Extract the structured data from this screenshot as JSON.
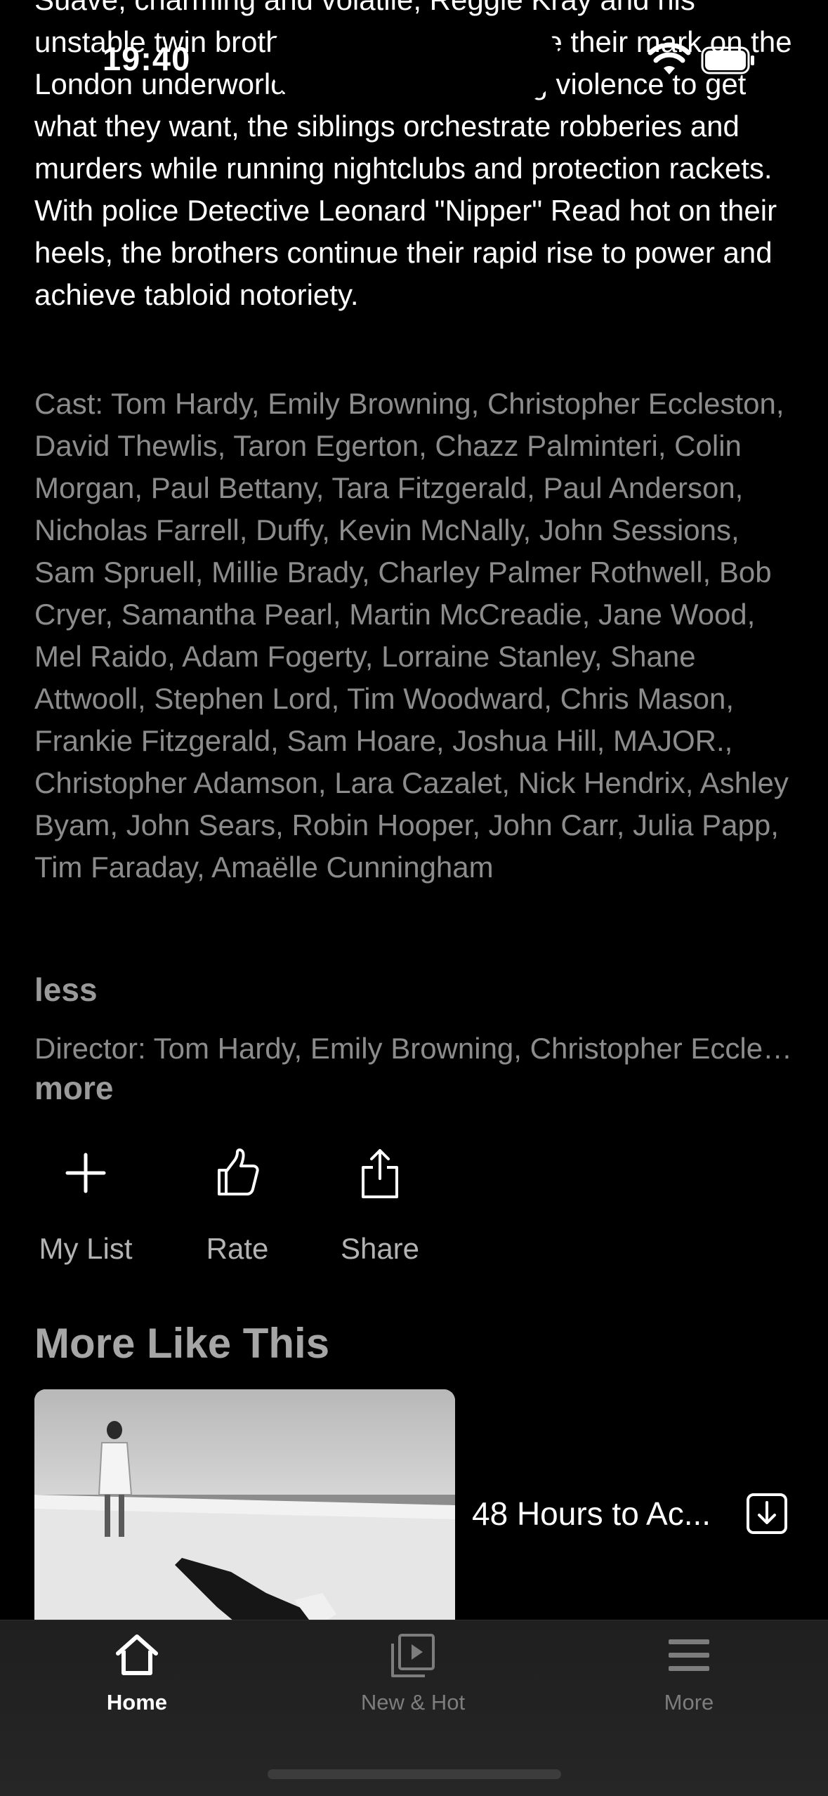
{
  "status_bar": {
    "time": "19:40"
  },
  "synopsis": "Suave, charming and volatile, Reggie Kray and his unstable twin brother Ronnie try to leave their mark on the London underworld in the 1960s. Using violence to get what they want, the siblings orchestrate robberies and murders while running nightclubs and protection rackets. With police Detective Leonard \"Nipper\" Read hot on their heels, the brothers continue their rapid rise to power and achieve tabloid notoriety.",
  "cast": "Cast: Tom Hardy, Emily Browning, Christopher Eccleston, David Thewlis, Taron Egerton, Chazz Palminteri, Colin Morgan, Paul Bettany, Tara Fitzgerald, Paul Anderson, Nicholas Farrell, Duffy, Kevin McNally, John Sessions, Sam Spruell, Millie Brady, Charley Palmer Rothwell, Bob Cryer, Samantha Pearl, Martin McCreadie, Jane Wood, Mel Raido, Adam Fogerty, Lorraine Stanley, Shane Attwooll, Stephen Lord, Tim Woodward, Chris Mason, Frankie Fitzgerald, Sam Hoare, Joshua Hill, MAJOR., Christopher Adamson, Lara Cazalet, Nick Hendrix, Ashley Byam, John Sears, Robin Hooper, John Carr, Julia Papp, Tim Faraday, Amaëlle Cunningham",
  "less_label": "less",
  "director": "Director: Tom Hardy, Emily Browning, Christopher Eccleston, David Thewlis",
  "more_label": "more",
  "actions": {
    "my_list": {
      "label": "My List",
      "icon": "plus-icon"
    },
    "rate": {
      "label": "Rate",
      "icon": "thumbs-up-icon"
    },
    "share": {
      "label": "Share",
      "icon": "share-icon"
    }
  },
  "more_like_this": {
    "title": "More Like This",
    "items": [
      {
        "title": "48 Hours to Ac...",
        "icon": "download-icon"
      }
    ]
  },
  "tabbar": {
    "tabs": [
      {
        "label": "Home",
        "icon": "home-icon",
        "active": true
      },
      {
        "label": "New & Hot",
        "icon": "play-stack-icon",
        "active": false
      },
      {
        "label": "More",
        "icon": "menu-icon",
        "active": false
      }
    ]
  },
  "colors": {
    "background": "#000000",
    "secondary_text": "#8c8c8c",
    "tabbar": "#222222"
  }
}
